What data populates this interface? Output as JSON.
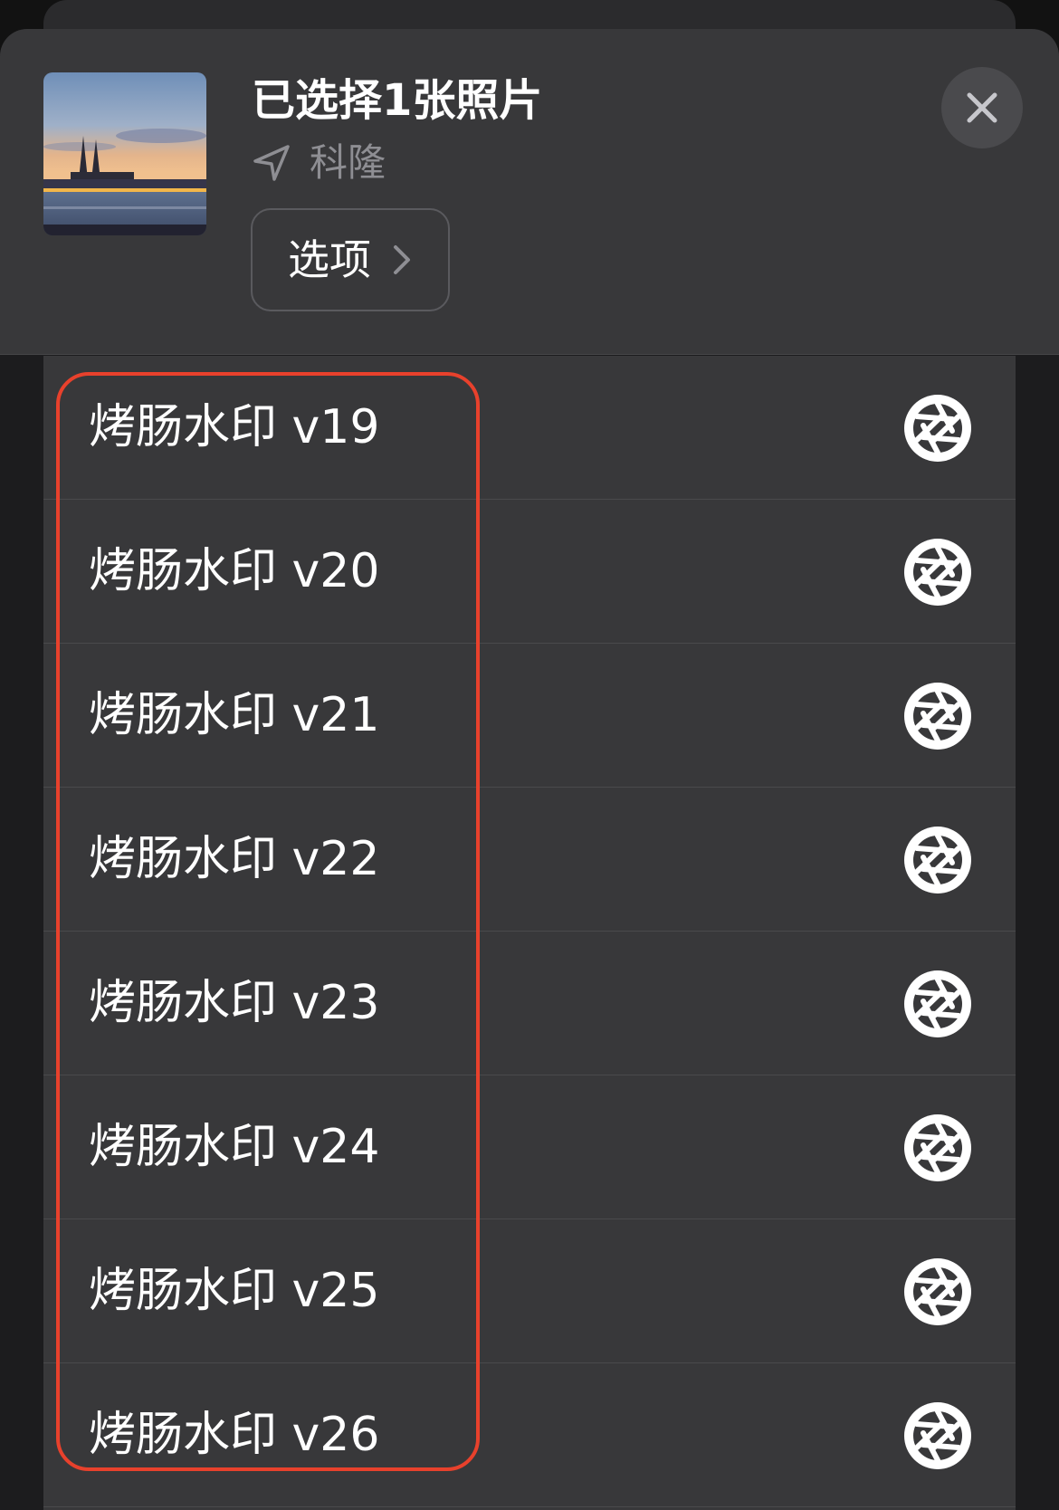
{
  "header": {
    "title": "已选择1张照片",
    "location": "科隆",
    "options_label": "选项"
  },
  "icons": {
    "thumbnail": "photo-thumbnail",
    "location": "location-arrow-icon",
    "options_chevron": "chevron-right-icon",
    "close": "close-icon",
    "row_action": "aperture-shutter-icon"
  },
  "list": {
    "items": [
      {
        "label": "烤肠水印 v19"
      },
      {
        "label": "烤肠水印 v20"
      },
      {
        "label": "烤肠水印 v21"
      },
      {
        "label": "烤肠水印 v22"
      },
      {
        "label": "烤肠水印 v23"
      },
      {
        "label": "烤肠水印 v24"
      },
      {
        "label": "烤肠水印 v25"
      },
      {
        "label": "烤肠水印 v26"
      }
    ]
  },
  "colors": {
    "background": "#1c1c1e",
    "header_bg": "#38383a",
    "list_bg": "#38383a",
    "text_primary": "#ffffff",
    "text_secondary": "#8e8e93",
    "highlight_border": "#e8412c"
  }
}
